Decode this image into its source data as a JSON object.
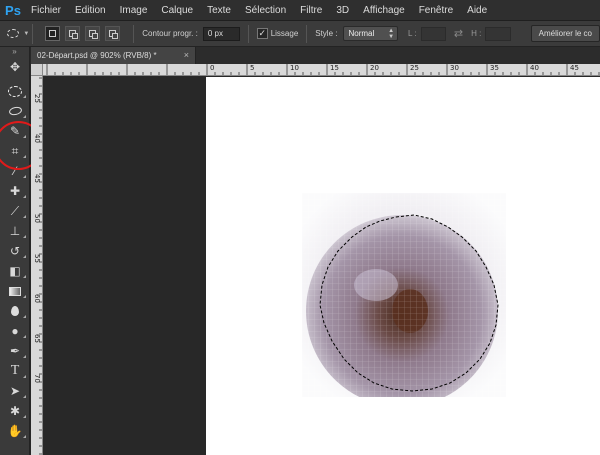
{
  "app": {
    "logo": "Ps"
  },
  "menu": [
    "Fichier",
    "Edition",
    "Image",
    "Calque",
    "Texte",
    "Sélection",
    "Filtre",
    "3D",
    "Affichage",
    "Fenêtre",
    "Aide"
  ],
  "options": {
    "feather_label": "Contour progr. :",
    "feather_value": "0 px",
    "antialias_label": "Lissage",
    "antialias_checked": true,
    "style_label": "Style :",
    "style_value": "Normal",
    "width_label": "L :",
    "height_label": "H :",
    "refine_button": "Améliorer le co"
  },
  "document": {
    "tab_title": "02-Départ.psd @ 902% (RVB/8) *",
    "close_glyph": "×"
  },
  "ruler": {
    "top_numbers": [
      "0",
      "5",
      "10",
      "15",
      "20",
      "25",
      "30",
      "35",
      "40",
      "45"
    ],
    "left_numbers": [
      "25",
      "40",
      "45",
      "50",
      "55",
      "60",
      "65",
      "70"
    ]
  },
  "toolbar": {
    "tools": [
      "move-tool",
      "elliptical-marquee-tool",
      "lasso-tool",
      "quick-selection-tool",
      "crop-tool",
      "eyedropper-tool",
      "healing-brush-tool",
      "brush-tool",
      "clone-stamp-tool",
      "history-brush-tool",
      "eraser-tool",
      "gradient-tool",
      "blur-tool",
      "dodge-tool",
      "pen-tool",
      "type-tool",
      "path-selection-tool",
      "shape-tool",
      "hand-tool"
    ],
    "highlight_color": "#e01a1a"
  },
  "colors": {
    "accent": "#2fa3f2",
    "menubar_bg": "#2f2f2f",
    "panel_bg": "#3a3a3a",
    "canvas_bg": "#ffffff"
  }
}
